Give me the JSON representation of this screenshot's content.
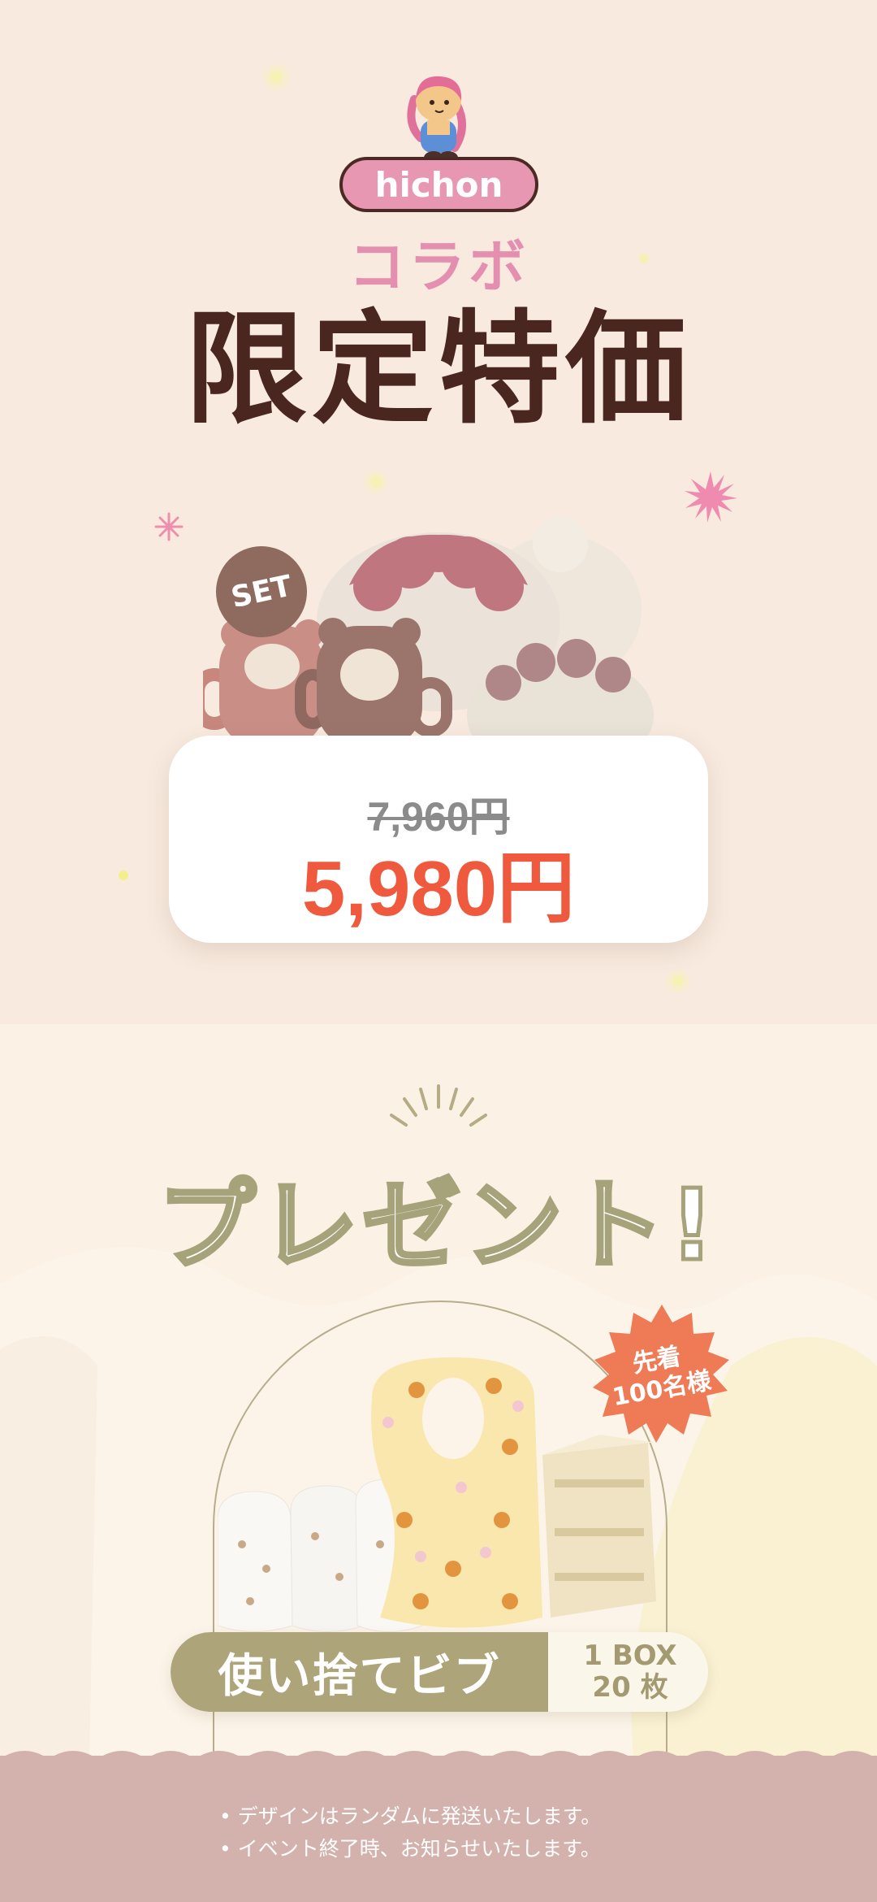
{
  "hero": {
    "brand_pill": "hichon",
    "collab_text": "コラボ",
    "title": "限定特価",
    "set_badge": "SET",
    "old_price": "7,960円",
    "new_price": "5,980円"
  },
  "present": {
    "title": "プレゼント!",
    "badge_line1": "先着",
    "badge_line2": "100名様",
    "item_label": "使い捨てビブ",
    "qty_line1": "1 BOX",
    "qty_line2": "20 枚"
  },
  "notes": [
    "デザインはランダムに発送いたします。",
    "イベント終了時、お知らせいたします。"
  ],
  "colors": {
    "background_top": "#f8eadf",
    "title_brown": "#4a2621",
    "pink": "#e897b3",
    "price_red": "#ef5a3e",
    "olive": "#aea479",
    "footer_mauve": "#d3b1ac"
  }
}
